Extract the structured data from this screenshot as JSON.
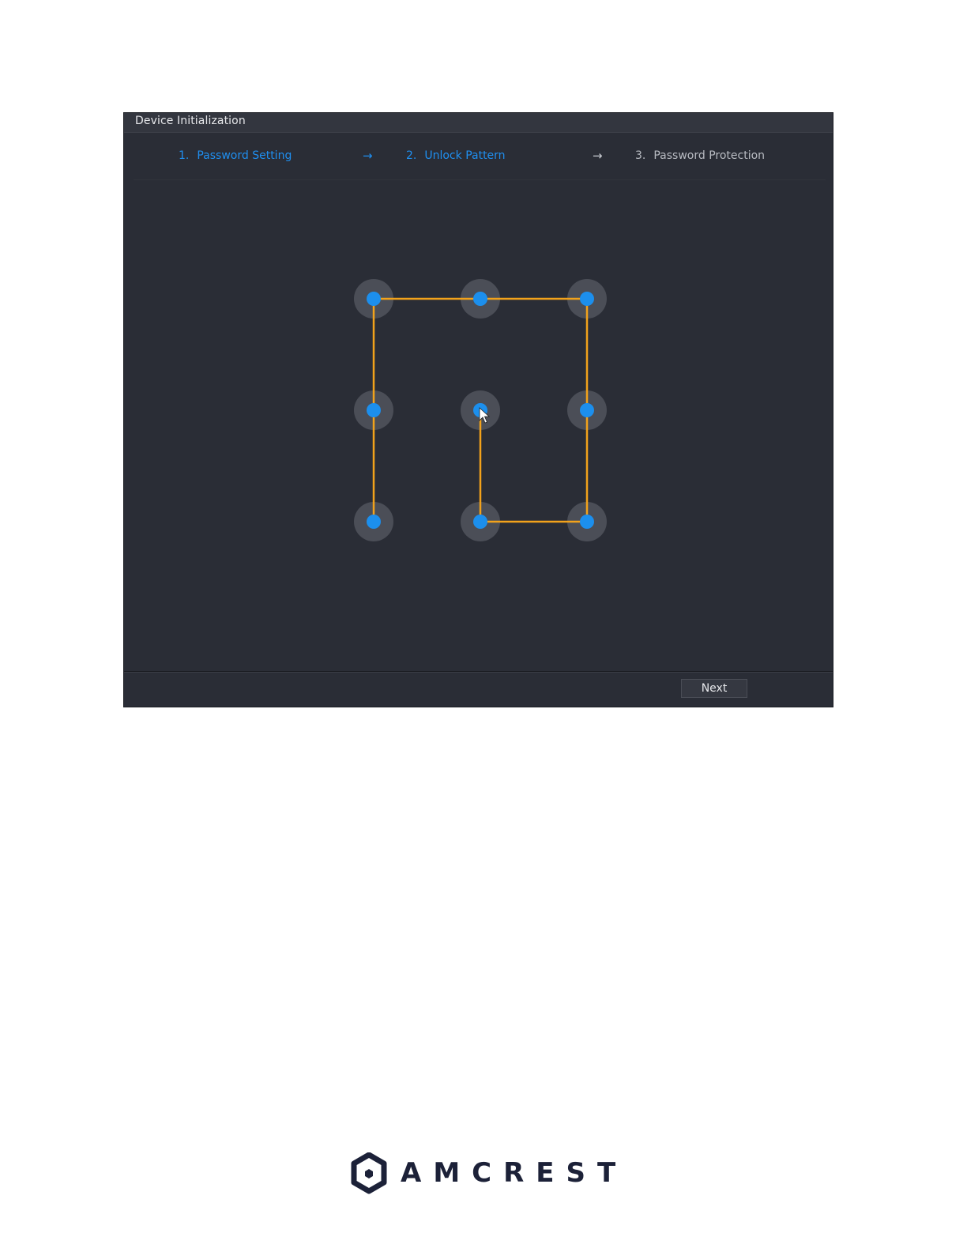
{
  "dialog": {
    "title": "Device Initialization",
    "steps": [
      {
        "num": "1.",
        "label": "Password Setting",
        "state": "active"
      },
      {
        "num": "2.",
        "label": "Unlock Pattern",
        "state": "active"
      },
      {
        "num": "3.",
        "label": "Password Protection",
        "state": "inactive"
      }
    ],
    "step_arrow": "→"
  },
  "pattern": {
    "grid": "3x3",
    "path_sequence": [
      1,
      3,
      9,
      8,
      5
    ],
    "also_connected": [
      7,
      4
    ],
    "line_color": "#f2a21b",
    "dot_color": "#1c8fed",
    "ring_color": "#4b4e57"
  },
  "footer": {
    "next_label": "Next"
  },
  "brand": {
    "name": "AMCREST",
    "color": "#1c2138"
  }
}
